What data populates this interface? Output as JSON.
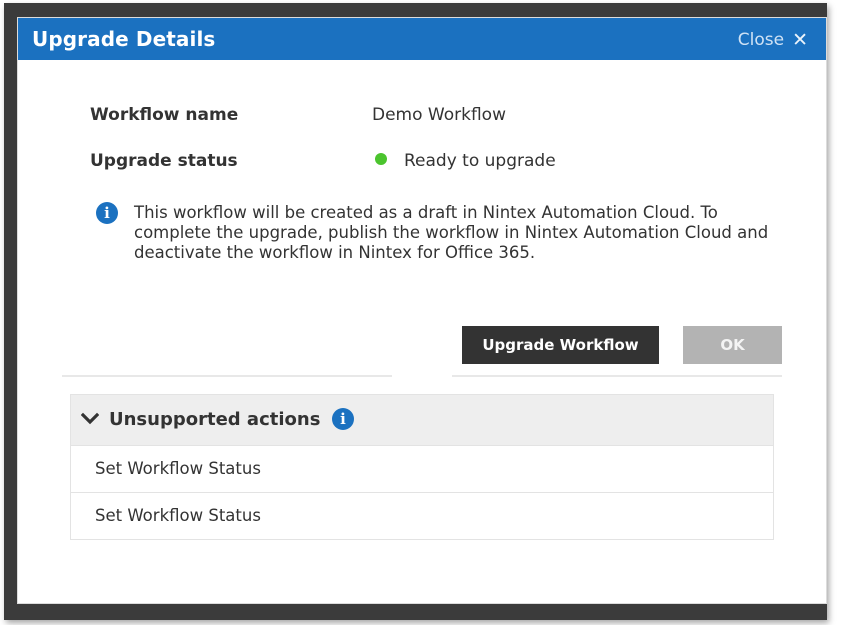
{
  "dialog": {
    "title": "Upgrade Details",
    "close_label": "Close",
    "close_icon": "close-x-icon"
  },
  "fields": {
    "workflow_name_label": "Workflow name",
    "workflow_name_value": "Demo Workflow",
    "upgrade_status_label": "Upgrade status",
    "upgrade_status_value": "Ready to upgrade",
    "status_color": "#4bc42e"
  },
  "info": {
    "icon": "info-icon",
    "message": "This workflow will be created as a draft in Nintex Automation Cloud. To complete the upgrade, publish the workflow in Nintex Automation Cloud and deactivate the workflow in Nintex for Office 365."
  },
  "buttons": {
    "upgrade_label": "Upgrade Workflow",
    "ok_label": "OK"
  },
  "unsupported": {
    "title": "Unsupported actions",
    "items": [
      "Set Workflow Status",
      "Set Workflow Status"
    ]
  },
  "colors": {
    "accent": "#1b71c0",
    "dark_button": "#333333",
    "disabled_button": "#b3b3b3"
  }
}
